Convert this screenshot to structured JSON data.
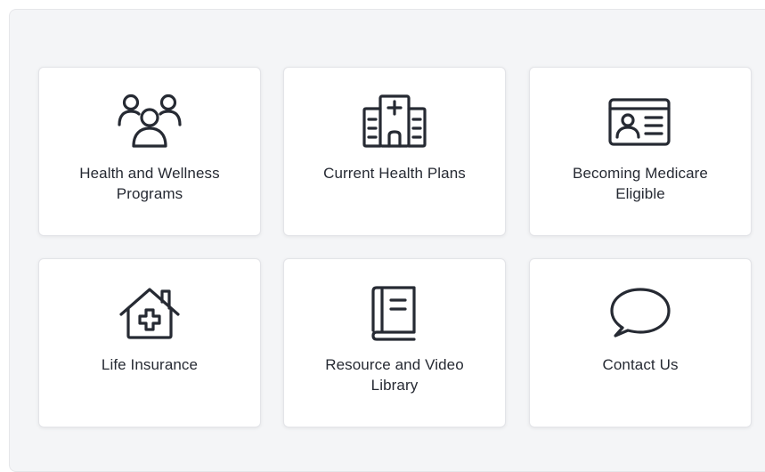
{
  "cards": [
    {
      "label": "Health and Wellness Programs",
      "icon": "people-group-icon"
    },
    {
      "label": "Current Health Plans",
      "icon": "hospital-icon"
    },
    {
      "label": "Becoming Medicare Eligible",
      "icon": "id-card-icon"
    },
    {
      "label": "Life Insurance",
      "icon": "house-medical-icon"
    },
    {
      "label": "Resource and Video Library",
      "icon": "book-icon"
    },
    {
      "label": "Contact Us",
      "icon": "chat-bubble-icon"
    }
  ],
  "colors": {
    "panel_background": "#f4f5f7",
    "card_background": "#ffffff",
    "text": "#262a33",
    "icon_stroke": "#262a33"
  }
}
